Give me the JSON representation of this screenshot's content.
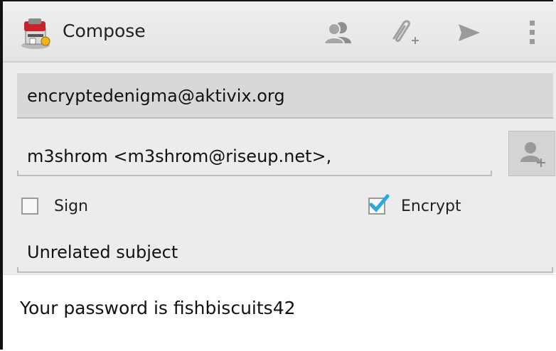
{
  "actionbar": {
    "title": "Compose",
    "icons": [
      "app-icon",
      "contacts-icon",
      "attach-icon",
      "send-icon",
      "overflow-menu-icon"
    ]
  },
  "from": {
    "value": "encryptedenigma@aktivix.org"
  },
  "to": {
    "value": "m3shrom <m3shrom@riseup.net>,"
  },
  "options": {
    "sign_label": "Sign",
    "sign_checked": false,
    "encrypt_label": "Encrypt",
    "encrypt_checked": true
  },
  "subject": {
    "value": "Unrelated subject"
  },
  "message": {
    "value": "Your password is fishbiscuits42"
  },
  "colors": {
    "checkmark": "#2aa9e0",
    "icon_gray": "#9a9a9a"
  }
}
